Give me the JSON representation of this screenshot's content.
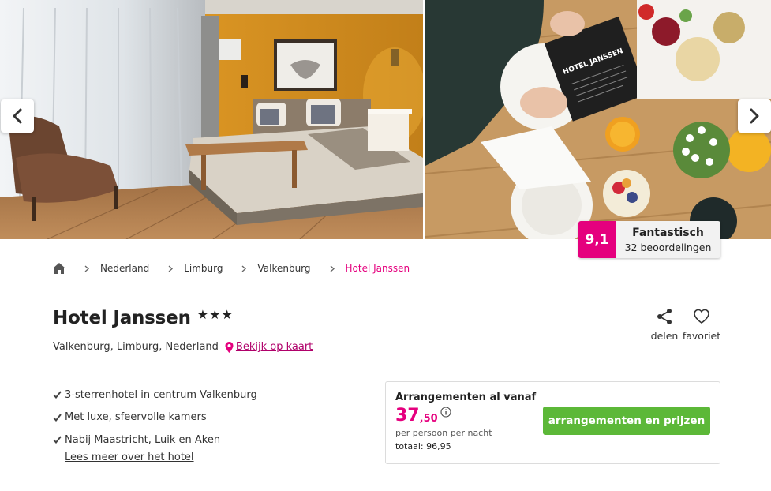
{
  "gallery": {
    "photos": [
      {
        "icon": "hotel-room-photo"
      },
      {
        "icon": "breakfast-table-photo",
        "menu_text": "HOTEL JANSSEN"
      }
    ],
    "prev_icon": "chevron-left-icon",
    "next_icon": "chevron-right-icon"
  },
  "rating": {
    "score": "9,1",
    "label": "Fantastisch",
    "count": "32 beoordelingen"
  },
  "breadcrumb": {
    "home_icon": "home-icon",
    "items": [
      "Nederland",
      "Limburg",
      "Valkenburg"
    ],
    "current": "Hotel Janssen"
  },
  "hotel": {
    "name": "Hotel Janssen",
    "stars": "★★★",
    "location": "Valkenburg, Limburg, Nederland",
    "map_link": "Bekijk op kaart"
  },
  "actions": {
    "share": "delen",
    "favorite": "favoriet"
  },
  "usps": [
    "3-sterrenhotel in centrum Valkenburg",
    "Met luxe, sfeervolle kamers",
    "Nabij Maastricht, Luik en Aken"
  ],
  "more_link": "Lees meer over het hotel",
  "price": {
    "heading": "Arrangementen al vanaf",
    "main": "37",
    "decimal": ",50",
    "per": "per persoon per nacht",
    "total": "totaal: 96,95",
    "cta": "arrangementen en prijzen"
  },
  "colors": {
    "accent": "#e5007e",
    "cta": "#5cb838"
  }
}
